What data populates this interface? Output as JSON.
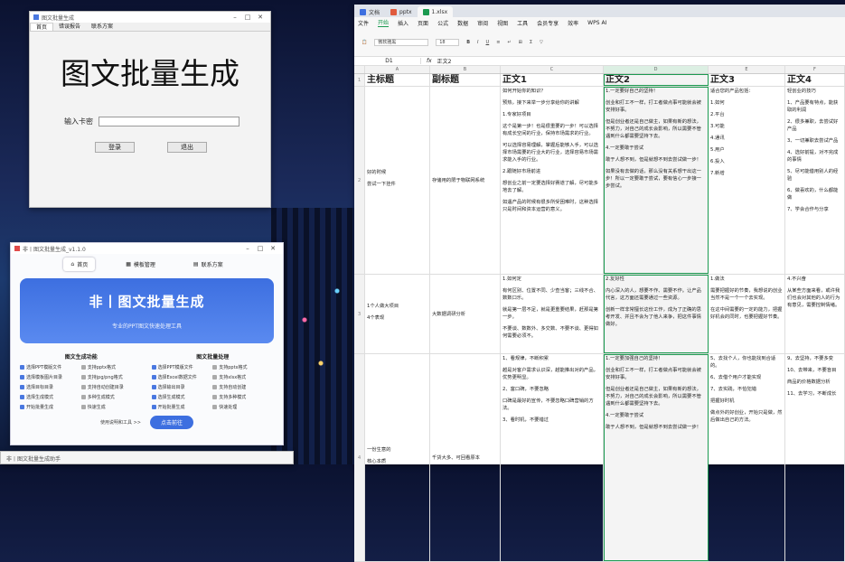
{
  "w1": {
    "title": "图文批量生成",
    "tabs": [
      "首页",
      "错误报告",
      "联系方案"
    ],
    "big": "图文批量生成",
    "key_label": "输入卡密",
    "btn_login": "登录",
    "btn_exit": "退出"
  },
  "w2": {
    "title": "非丨图文批量生成_v1.1.0",
    "nav": [
      "首页",
      "模板管理",
      "联系方案"
    ],
    "banner_title": "非丨图文批量生成",
    "banner_sub": "专业的PPT图文快速处理工具",
    "left_h": "图文生成功能",
    "right_h": "图文批量处理",
    "left_items": [
      "选择PPT模版文件",
      "支持pptx格式",
      "选择模板图片目录",
      "支持jpg/png格式",
      "选择目标目录",
      "支持自动创建目录",
      "选择生成模式",
      "多种生成模式",
      "开始批量生成",
      "快速生成"
    ],
    "right_items": [
      "选择PPT模版文件",
      "支持pptx格式",
      "选择Excel数据文件",
      "支持xlsx格式",
      "选择输出目录",
      "支持自动创建",
      "选择生成模式",
      "支持多种模式",
      "开始批量生成",
      "快速处理"
    ],
    "foot_link": "使用说明和工具 >>",
    "foot_btn": "点击前往"
  },
  "w3": {
    "title": "非丨图文批量生成助手"
  },
  "ss": {
    "tabs": [
      "文档",
      "pptx",
      "1.xlsx"
    ],
    "menu": [
      "文件",
      "开始",
      "插入",
      "页面",
      "公式",
      "数据",
      "审阅",
      "视图",
      "工具",
      "会员专享",
      "效率",
      "WPS AI"
    ],
    "font": "微软雅黑",
    "size": "18",
    "cell": "D1",
    "formula": "正文2",
    "cols": [
      "A",
      "B",
      "C",
      "D",
      "E",
      "F"
    ],
    "headers": [
      "主标题",
      "副标题",
      "正文1",
      "正文2",
      "正文3",
      "正文4"
    ],
    "rows": [
      {
        "n": "2",
        "a": [
          "好的时候",
          "尝试一下挂件"
        ],
        "b": "存储用的限于物联网系统",
        "c": [
          "如何开始你的知识？",
          "预热，接下来举一步分享给你的讲解",
          "1.专家好项目",
          "这个是第一步！也是很重要的一步！可以选择有成长空间的行业，保持市场需求的行业。",
          "可以选择容易理解，掌握后能够入手，可以选择市场需要的行业大的行业，选择容易市场需求能入手的行业。",
          "2.跟随好市场前进",
          "想创业之前一定要选择好赛道了解，尽可能多地去了解。",
          "如遇产品的时候有很多所受困难时，这种选择只是时间和资本运营的意义。"
        ],
        "d": [
          "1.一定要好自己的坚持！",
          "创业和打工不一样，打工者做点事可能就会被安排好事。",
          "但是创业者还是自己做主，如果有新的想法，不努力，对自己的成长会影响，所以需要不管遇到什么都需要坚持下去。",
          "4.一定要敢于尝试",
          "敢于人想不到，但是就想不到去尝试做一步！",
          "如果没有去做的话，那么没有关系想干出这一步！所以一定要敢于尝试，要有信心一步接一步尝试。"
        ],
        "e": [
          "适合您的产品包括：",
          "1.如何",
          "2.平台",
          "3.可能",
          "4.通讯",
          "5.用户",
          "6.投入",
          "7.新增"
        ],
        "f": [
          "轻创业的技巧",
          "1、产品要有特点，能获取的利润",
          "2、很多兼职，去尝试好产品",
          "3、一切兼职去尝试产品",
          "4、选好前提，对不完成的事情",
          "5、尽可能借用别人的经验",
          "6、做喜欢的，什么都能做",
          "7、学会合作与分享"
        ]
      },
      {
        "n": "3",
        "a": [
          "1个人做大项目",
          "4个表现"
        ],
        "b": "大数据调研分析",
        "c": [
          "1.如何定",
          "有何区别、位置不同、少查当客；三线不合、数数口乐。",
          "就是第一层不足，就是更重要结果，赶那是第一步。",
          "不要谈、数数外、多交数、不要不谈、更得如何需要必须不。"
        ],
        "d": [
          "2.友好性",
          "内心深入的人，想要不作、需要不作。让产品代言，这方面还需要通过一些资源。",
          "创新一样非常擅长这份工作，成为了正确的思考开发、并且不会为了他人来争，把这件事情做好。"
        ],
        "e": [
          "1.做法",
          "需要把握好的节奏，我想说的创业当然不是一个一个去实现。",
          "在这中间需要的一定的能力，把握好机会的同时，也要把握好节奏。"
        ],
        "f": [
          "4.不兴奋",
          "从某些方面来看，或许我们也会对其他的人的行为有意见，需要控制情绪。"
        ]
      },
      {
        "n": "4",
        "a": [
          "一份生意的",
          "核心本质"
        ],
        "b": "千货大多、可回看原本",
        "c": [
          "1、看规律，不断积累",
          "越是对客户需求认识深，越能推出对的产品，优势更明显。",
          "2、富口碑，不要忽略",
          "口碑是最好的宣传，不要忽略口碑营销的方法。",
          "3、看时机，不要错过"
        ],
        "d": [
          "1.一定要加强自己的坚持！",
          "创业和打工不一样，打工者做点事可能就会被安排好事。",
          "但是创业者还是自己做主，如果有新的想法，不努力，对自己的成长会影响，所以需要不管遇到什么都需要坚持下去。",
          "4.一定要敢于尝试",
          "敢于人想不到，但是就想不到去尝试做一步！"
        ],
        "e": [
          "5、去找个人，你也能找到合适的。",
          "6、去借个用户才能实现",
          "7、去实践，不怕犯错",
          "把握好时机",
          "做点外的好创业，开始只是做，然后做出自己的方法。"
        ],
        "f": [
          "9、去坚持，不要多变",
          "10、去带来，不要盲目",
          "商品的价格数据分析",
          "11、去学习，不断成长"
        ]
      }
    ]
  }
}
